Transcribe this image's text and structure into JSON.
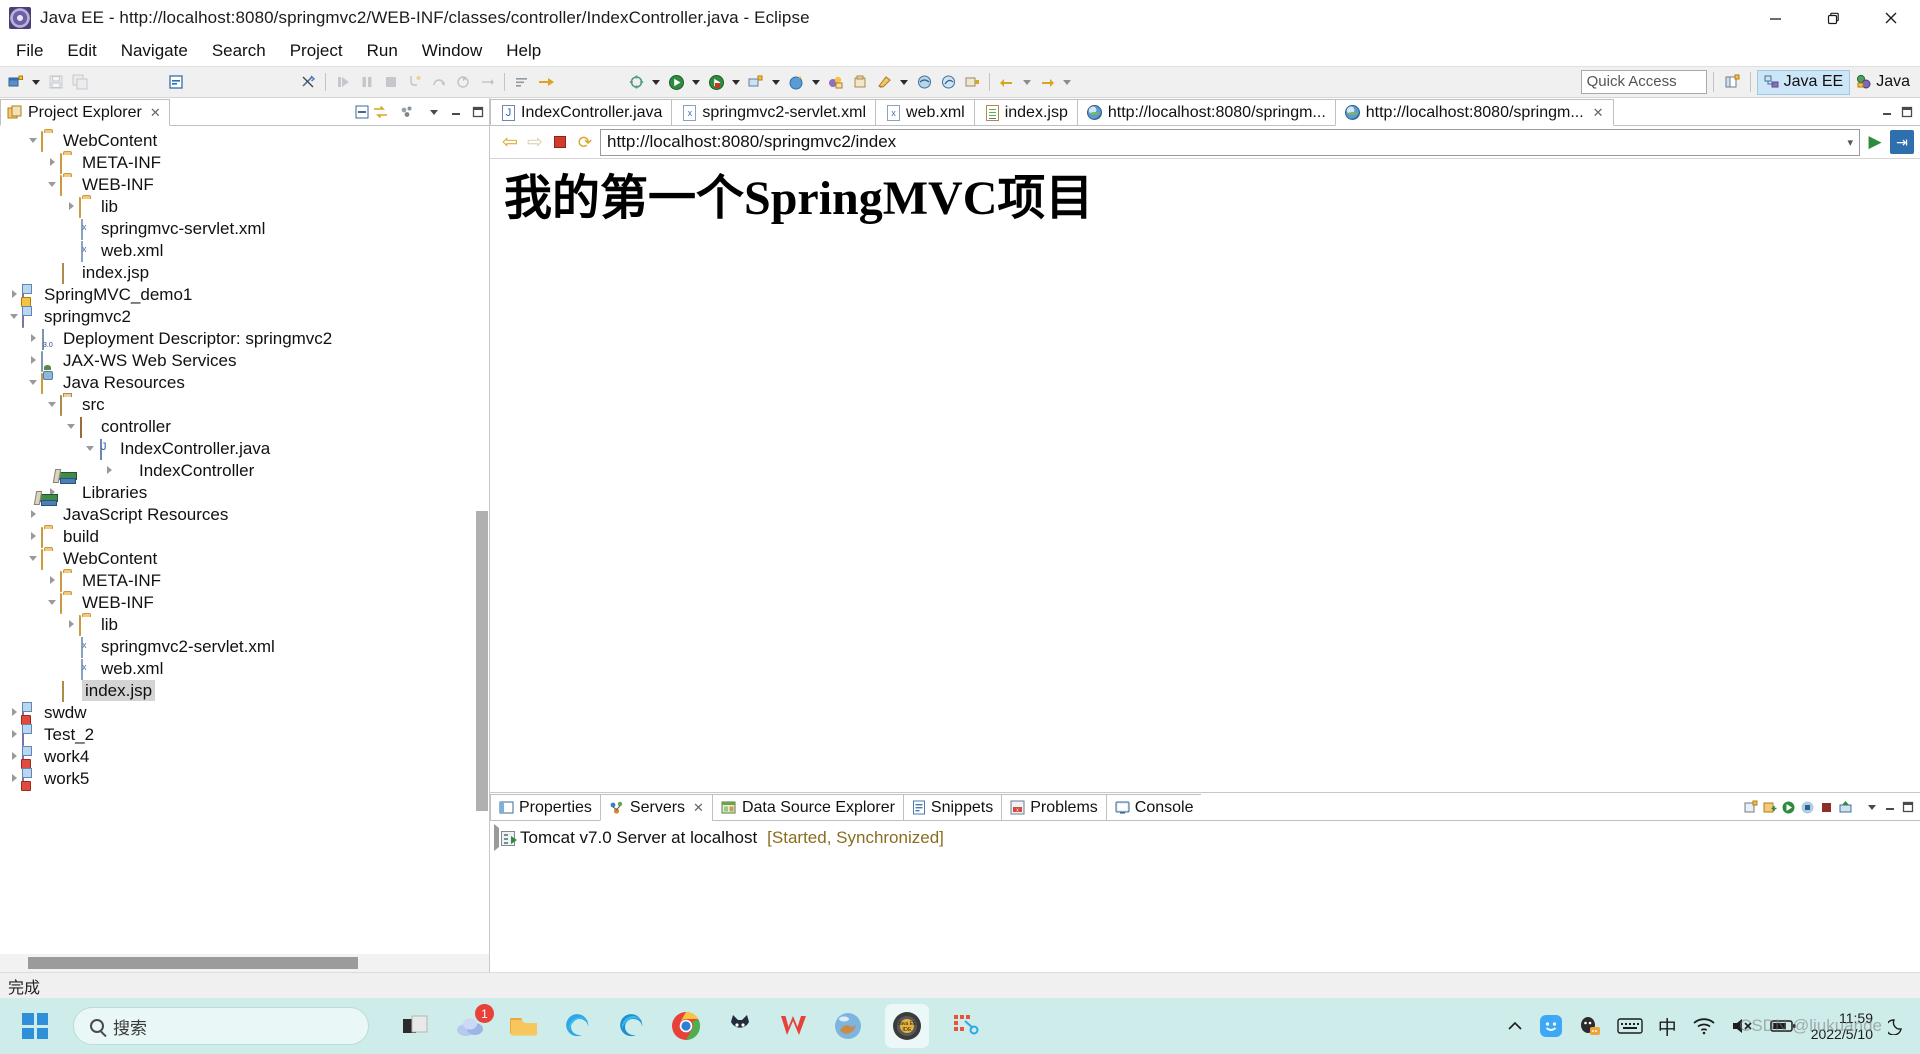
{
  "window": {
    "title": "Java EE - http://localhost:8080/springmvc2/WEB-INF/classes/controller/IndexController.java - Eclipse",
    "app_icon": "eclipse-icon",
    "minimize": "minimize-icon",
    "restore": "restore-icon",
    "close": "close-icon"
  },
  "menubar": {
    "items": [
      {
        "label": "File"
      },
      {
        "label": "Edit"
      },
      {
        "label": "Navigate"
      },
      {
        "label": "Search"
      },
      {
        "label": "Project"
      },
      {
        "label": "Run"
      },
      {
        "label": "Window"
      },
      {
        "label": "Help"
      }
    ]
  },
  "toolbar": {
    "quick_access_placeholder": "Quick Access",
    "open_perspective_icon": "open-perspective-icon",
    "perspectives": [
      {
        "label": "Java EE",
        "icon": "java-ee-perspective-icon",
        "active": true
      },
      {
        "label": "Java",
        "icon": "java-perspective-icon",
        "active": false
      }
    ],
    "buttons": [
      {
        "name": "new-wizard",
        "enabled": true
      },
      {
        "name": "new-dropdown",
        "enabled": true
      },
      {
        "name": "save",
        "enabled": false
      },
      {
        "name": "save-all",
        "enabled": false
      },
      {
        "name": "new-java-class",
        "enabled": true
      },
      {
        "name": "toggle-mark-occurrences",
        "enabled": false
      },
      {
        "name": "resume",
        "enabled": false
      },
      {
        "name": "suspend",
        "enabled": false
      },
      {
        "name": "terminate",
        "enabled": false
      },
      {
        "name": "step-into",
        "enabled": false
      },
      {
        "name": "step-over",
        "enabled": false
      },
      {
        "name": "step-return",
        "enabled": false
      },
      {
        "name": "skip-breakpoints",
        "enabled": false
      },
      {
        "name": "coverage",
        "enabled": true
      },
      {
        "name": "debug",
        "enabled": true
      },
      {
        "name": "run",
        "enabled": true
      },
      {
        "name": "run-external-tools",
        "enabled": true
      },
      {
        "name": "new-server",
        "enabled": true
      },
      {
        "name": "new-connection-profile",
        "enabled": true
      },
      {
        "name": "new-package",
        "enabled": true
      },
      {
        "name": "search",
        "enabled": true
      },
      {
        "name": "open-task",
        "enabled": true
      },
      {
        "name": "pin-editor",
        "enabled": true
      },
      {
        "name": "previous-annotation",
        "enabled": true
      },
      {
        "name": "next-annotation",
        "enabled": true
      },
      {
        "name": "back-history",
        "enabled": true
      },
      {
        "name": "forward-history",
        "enabled": true
      }
    ]
  },
  "explorer": {
    "view_title": "Project Explorer",
    "view_icon": "project-explorer-icon",
    "close_icon": "close-view-icon",
    "toolbar": [
      {
        "name": "collapse-all-icon"
      },
      {
        "name": "link-with-editor-icon"
      },
      {
        "name": "view-menu-dots-icon"
      },
      {
        "name": "view-menu-icon"
      },
      {
        "name": "minimize-view-icon"
      },
      {
        "name": "maximize-view-icon"
      }
    ],
    "tree": [
      {
        "label": "WebContent",
        "indent": 1,
        "twisty": "down",
        "icon": "folder-icon",
        "selected": false
      },
      {
        "label": "META-INF",
        "indent": 2,
        "twisty": "right",
        "icon": "folder-icon",
        "selected": false
      },
      {
        "label": "WEB-INF",
        "indent": 2,
        "twisty": "down",
        "icon": "folder-icon",
        "selected": false
      },
      {
        "label": "lib",
        "indent": 3,
        "twisty": "right",
        "icon": "folder-icon",
        "selected": false
      },
      {
        "label": "springmvc-servlet.xml",
        "indent": 3,
        "twisty": "none",
        "icon": "xml-file-icon",
        "selected": false
      },
      {
        "label": "web.xml",
        "indent": 3,
        "twisty": "none",
        "icon": "xml-file-icon",
        "selected": false
      },
      {
        "label": "index.jsp",
        "indent": 2,
        "twisty": "none",
        "icon": "jsp-file-icon",
        "selected": false
      },
      {
        "label": "SpringMVC_demo1",
        "indent": 0,
        "twisty": "right",
        "icon": "web-project-warn-icon",
        "selected": false
      },
      {
        "label": "springmvc2",
        "indent": 0,
        "twisty": "down",
        "icon": "web-project-icon",
        "selected": false
      },
      {
        "label": "Deployment Descriptor: springmvc2",
        "indent": 1,
        "twisty": "right",
        "icon": "deployment-descriptor-icon",
        "selected": false
      },
      {
        "label": "JAX-WS Web Services",
        "indent": 1,
        "twisty": "right",
        "icon": "web-services-icon",
        "selected": false
      },
      {
        "label": "Java Resources",
        "indent": 1,
        "twisty": "down",
        "icon": "java-resources-icon",
        "selected": false
      },
      {
        "label": "src",
        "indent": 2,
        "twisty": "down",
        "icon": "source-folder-icon",
        "selected": false
      },
      {
        "label": "controller",
        "indent": 3,
        "twisty": "down",
        "icon": "package-icon",
        "selected": false
      },
      {
        "label": "IndexController.java",
        "indent": 4,
        "twisty": "down",
        "icon": "java-file-icon",
        "selected": false
      },
      {
        "label": "IndexController",
        "indent": 5,
        "twisty": "right",
        "icon": "java-class-icon",
        "selected": false
      },
      {
        "label": "Libraries",
        "indent": 2,
        "twisty": "right",
        "icon": "libraries-icon",
        "selected": false
      },
      {
        "label": "JavaScript Resources",
        "indent": 1,
        "twisty": "right",
        "icon": "libraries-icon",
        "selected": false
      },
      {
        "label": "build",
        "indent": 1,
        "twisty": "right",
        "icon": "folder-icon",
        "selected": false
      },
      {
        "label": "WebContent",
        "indent": 1,
        "twisty": "down",
        "icon": "folder-icon",
        "selected": false
      },
      {
        "label": "META-INF",
        "indent": 2,
        "twisty": "right",
        "icon": "folder-icon",
        "selected": false
      },
      {
        "label": "WEB-INF",
        "indent": 2,
        "twisty": "down",
        "icon": "folder-icon",
        "selected": false
      },
      {
        "label": "lib",
        "indent": 3,
        "twisty": "right",
        "icon": "folder-icon",
        "selected": false
      },
      {
        "label": "springmvc2-servlet.xml",
        "indent": 3,
        "twisty": "none",
        "icon": "xml-file-icon",
        "selected": false
      },
      {
        "label": "web.xml",
        "indent": 3,
        "twisty": "none",
        "icon": "xml-file-icon",
        "selected": false
      },
      {
        "label": "index.jsp",
        "indent": 2,
        "twisty": "none",
        "icon": "jsp-file-icon",
        "selected": true
      },
      {
        "label": "swdw",
        "indent": 0,
        "twisty": "right",
        "icon": "web-project-err-icon",
        "selected": false
      },
      {
        "label": "Test_2",
        "indent": 0,
        "twisty": "right",
        "icon": "web-project-icon",
        "selected": false
      },
      {
        "label": "work4",
        "indent": 0,
        "twisty": "right",
        "icon": "web-project-err-icon",
        "selected": false
      },
      {
        "label": "work5",
        "indent": 0,
        "twisty": "right",
        "icon": "web-project-err-icon",
        "selected": false
      }
    ]
  },
  "editor": {
    "tabs": [
      {
        "label": "IndexController.java",
        "icon": "java-file-icon",
        "active": false,
        "closable": false
      },
      {
        "label": "springmvc2-servlet.xml",
        "icon": "xml-file-icon",
        "active": false,
        "closable": false
      },
      {
        "label": "web.xml",
        "icon": "xml-file-icon",
        "active": false,
        "closable": false
      },
      {
        "label": "index.jsp",
        "icon": "jsp-file-icon",
        "active": false,
        "closable": false
      },
      {
        "label": "http://localhost:8080/springm...",
        "icon": "globe-icon",
        "active": false,
        "closable": false
      },
      {
        "label": "http://localhost:8080/springm...",
        "icon": "globe-icon",
        "active": true,
        "closable": true
      }
    ],
    "tab_controls": [
      {
        "name": "minimize-editor-icon"
      },
      {
        "name": "maximize-editor-icon"
      }
    ],
    "browser": {
      "back_icon": "back-arrow-icon",
      "forward_icon": "forward-arrow-icon",
      "stop_icon": "stop-icon",
      "refresh_icon": "refresh-icon",
      "url": "http://localhost:8080/springmvc2/index",
      "dropdown_icon": "chevron-down-icon",
      "go_icon": "go-play-icon",
      "open-external_icon": "open-external-browser-icon"
    },
    "page": {
      "heading": "我的第一个SpringMVC项目"
    }
  },
  "bottom_panel": {
    "tabs": [
      {
        "label": "Properties",
        "icon": "properties-icon",
        "active": false,
        "closable": false
      },
      {
        "label": "Servers",
        "icon": "servers-icon",
        "active": true,
        "closable": true
      },
      {
        "label": "Data Source Explorer",
        "icon": "data-source-icon",
        "active": false,
        "closable": false
      },
      {
        "label": "Snippets",
        "icon": "snippets-icon",
        "active": false,
        "closable": false
      },
      {
        "label": "Problems",
        "icon": "problems-icon",
        "active": false,
        "closable": false
      },
      {
        "label": "Console",
        "icon": "console-icon",
        "active": false,
        "closable": false
      }
    ],
    "tab_controls": [
      {
        "name": "new-server-icon"
      },
      {
        "name": "add-remove-projects-icon"
      },
      {
        "name": "start-server-icon"
      },
      {
        "name": "debug-server-icon"
      },
      {
        "name": "stop-server-icon"
      },
      {
        "name": "publish-server-icon"
      },
      {
        "name": "view-menu-icon"
      },
      {
        "name": "minimize-panel-icon"
      },
      {
        "name": "maximize-panel-icon"
      }
    ],
    "server": {
      "twisty": "right",
      "icon": "server-icon",
      "name": "Tomcat v7.0 Server at localhost",
      "status": "[Started, Synchronized]",
      "status_color": "#8a6d1f"
    }
  },
  "statusbar": {
    "message": "完成"
  },
  "taskbar": {
    "start_icon": "windows-start-icon",
    "search_placeholder": "搜索",
    "search_icon": "search-icon",
    "apps": [
      {
        "name": "task-view-icon",
        "badge": ""
      },
      {
        "name": "onedrive-icon",
        "badge": "1"
      },
      {
        "name": "file-explorer-icon",
        "badge": ""
      },
      {
        "name": "edge-icon",
        "badge": ""
      },
      {
        "name": "edge-browser-icon",
        "badge": ""
      },
      {
        "name": "chrome-icon",
        "badge": ""
      },
      {
        "name": "cat-app-icon",
        "badge": ""
      },
      {
        "name": "wps-office-icon",
        "badge": ""
      },
      {
        "name": "earth-app-icon",
        "badge": ""
      },
      {
        "name": "eclipse-java-ee-ide-icon",
        "badge": "",
        "active": true
      },
      {
        "name": "snipping-tool-icon",
        "badge": ""
      }
    ],
    "tray": [
      {
        "name": "show-hidden-icons-chevron-icon"
      },
      {
        "name": "smiley-app-icon"
      },
      {
        "name": "qq-icon"
      },
      {
        "name": "touch-keyboard-icon"
      },
      {
        "name": "ime-chinese-icon",
        "label": "中"
      },
      {
        "name": "wifi-icon"
      },
      {
        "name": "volume-muted-icon"
      },
      {
        "name": "battery-icon"
      }
    ],
    "clock": {
      "time": "11:59",
      "date": "2022/5/10"
    },
    "moon_icon": "moon-icon",
    "watermark": "CSDN @liukuande"
  }
}
